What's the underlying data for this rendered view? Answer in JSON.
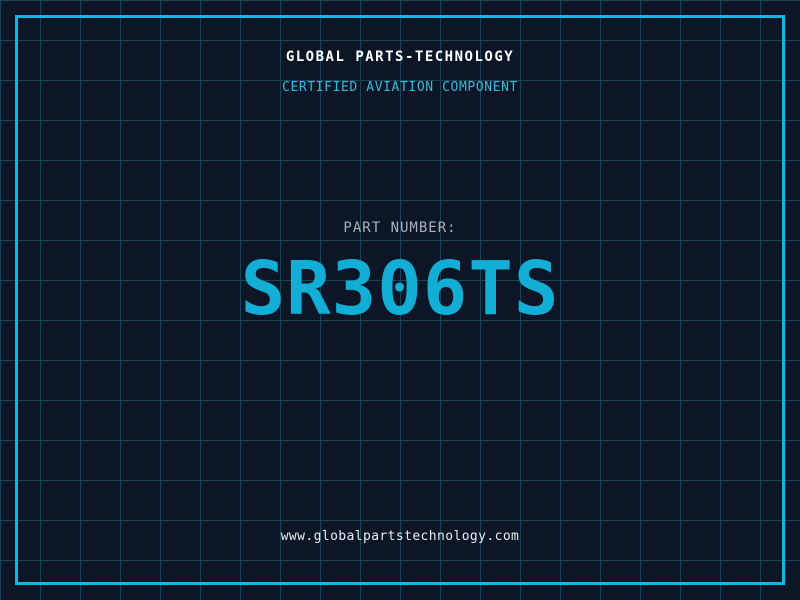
{
  "label": {
    "company_name": "GLOBAL PARTS-TECHNOLOGY",
    "certification": "CERTIFIED AVIATION COMPONENT",
    "part_label": "PART NUMBER:",
    "part_number": "SR306TS",
    "website": "www.globalpartstechnology.com"
  },
  "colors": {
    "background": "#0d1626",
    "grid_line": "#1a4557",
    "frame_accent": "#0fb8e2",
    "company_text": "#ffffff",
    "certification_text": "#38b8d8",
    "part_label_text": "#a9b2bc",
    "part_number_text": "#12aed6",
    "website_text": "#e9edf1"
  }
}
